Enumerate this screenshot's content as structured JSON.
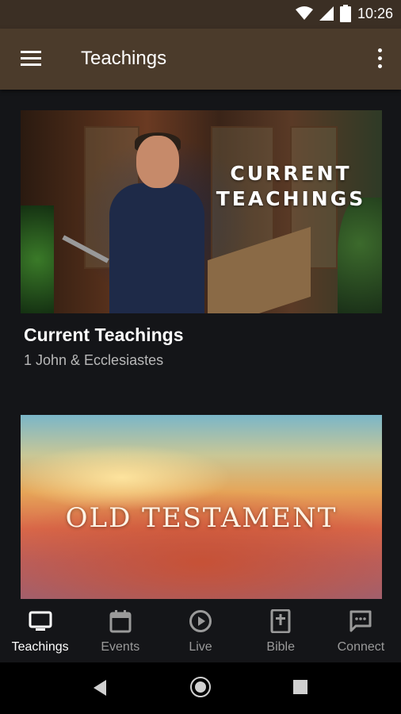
{
  "status_bar": {
    "time": "10:26",
    "icons": [
      "wifi-icon",
      "cell-signal-icon",
      "battery-icon"
    ]
  },
  "app_bar": {
    "title": "Teachings",
    "icons": [
      "menu-icon",
      "overflow-menu-icon"
    ]
  },
  "cards": [
    {
      "image_text": "CURRENT TEACHINGS",
      "title": "Current Teachings",
      "subtitle": "1 John & Ecclesiastes"
    },
    {
      "image_text": "OLD TESTAMENT",
      "title": "",
      "subtitle": ""
    }
  ],
  "bottom_nav": {
    "items": [
      {
        "label": "Teachings",
        "icon": "tv-icon",
        "active": true
      },
      {
        "label": "Events",
        "icon": "calendar-icon",
        "active": false
      },
      {
        "label": "Live",
        "icon": "play-circle-icon",
        "active": false
      },
      {
        "label": "Bible",
        "icon": "bible-icon",
        "active": false
      },
      {
        "label": "Connect",
        "icon": "chat-icon",
        "active": false
      }
    ]
  },
  "system_nav": {
    "icons": [
      "back-icon",
      "home-icon",
      "recents-icon"
    ]
  },
  "colors": {
    "status_bar": "#3b2f24",
    "app_bar": "#4b3b2b",
    "background": "#141518",
    "active_nav": "#ffffff",
    "inactive_nav": "#9a9a9a"
  }
}
